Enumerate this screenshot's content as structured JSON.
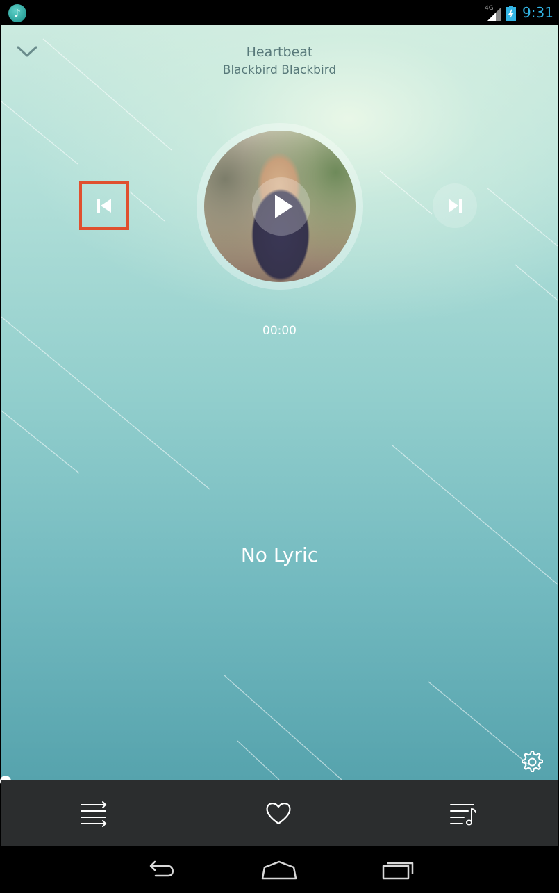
{
  "status_bar": {
    "network": "4G",
    "time": "9:31"
  },
  "player": {
    "title": "Heartbeat",
    "artist": "Blackbird Blackbird",
    "elapsed": "00:00",
    "lyric": "No Lyric",
    "progress": 0
  },
  "icons": {
    "app": "music-note-icon",
    "collapse": "chevron-down-icon",
    "previous": "skip-previous-icon",
    "play": "play-icon",
    "next": "skip-next-icon",
    "settings": "gear-icon",
    "queue": "shuffle-icon",
    "favorite": "heart-icon",
    "playlist": "playlist-icon",
    "back": "back-icon",
    "home": "home-icon",
    "recents": "recent-apps-icon"
  },
  "colors": {
    "accent_status": "#33b5e5",
    "highlight_box": "#e0502e",
    "toolbar_bg": "#2b2d2e"
  }
}
